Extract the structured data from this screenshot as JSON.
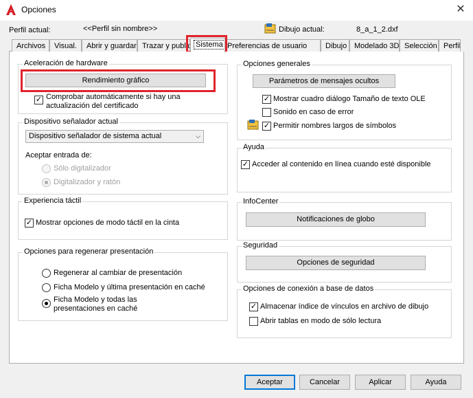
{
  "window": {
    "title": "Opciones",
    "close_glyph": "✕"
  },
  "profile": {
    "label": "Perfil actual:",
    "value": "<<Perfil sin nombre>>",
    "drawing_label": "Dibujo actual:",
    "drawing_value": "8_a_1_2.dxf"
  },
  "tabs": [
    {
      "label": "Archivos"
    },
    {
      "label": "Visual."
    },
    {
      "label": "Abrir y guardar"
    },
    {
      "label": "Trazar y publicar"
    },
    {
      "label": "Sistema"
    },
    {
      "label": "Preferencias de usuario"
    },
    {
      "label": "Dibujo"
    },
    {
      "label": "Modelado 3D"
    },
    {
      "label": "Selección"
    },
    {
      "label": "Perfil"
    }
  ],
  "hardware": {
    "title": "Aceleración de hardware",
    "button": "Rendimiento gráfico",
    "check_line1": "Comprobar automáticamente si hay una",
    "check_line2": "actualización del certificado"
  },
  "pointing": {
    "title": "Dispositivo señalador actual",
    "select": "Dispositivo señalador de sistema actual",
    "accept_label": "Aceptar entrada de:",
    "radio1": "Sólo digitalizador",
    "radio2": "Digitalizador y ratón"
  },
  "touch": {
    "title": "Experiencia táctil",
    "check": "Mostrar opciones de modo táctil en la cinta"
  },
  "regen": {
    "title": "Opciones para regenerar presentación",
    "radio1": "Regenerar al cambiar de presentación",
    "radio2": "Ficha Modelo y última presentación en caché",
    "radio3_line1": "Ficha Modelo y todas las",
    "radio3_line2": "presentaciones en caché"
  },
  "general": {
    "title": "Opciones generales",
    "button": "Parámetros de mensajes ocultos",
    "check1": "Mostrar cuadro diálogo Tamaño de texto OLE",
    "check2": "Sonido en caso de error",
    "check3": "Permitir nombres largos de símbolos"
  },
  "help": {
    "title": "Ayuda",
    "check": "Acceder al contenido en línea cuando esté disponible"
  },
  "infocenter": {
    "title": "InfoCenter",
    "button": "Notificaciones de globo"
  },
  "security": {
    "title": "Seguridad",
    "button": "Opciones de seguridad"
  },
  "db": {
    "title": "Opciones de conexión a base de datos",
    "check1": "Almacenar índice de vínculos en archivo de dibujo",
    "check2": "Abrir tablas en modo de sólo lectura"
  },
  "footer": {
    "accept": "Aceptar",
    "cancel": "Cancelar",
    "apply": "Aplicar",
    "help": "Ayuda"
  },
  "colors": {
    "highlight": "#e0232c",
    "brand": "#d41f27",
    "default_button_border": "#0078d7"
  },
  "icons": {
    "app": "autocad-logo-icon",
    "drawing": "drawing-file-icon",
    "symbols": "symbol-names-icon"
  }
}
